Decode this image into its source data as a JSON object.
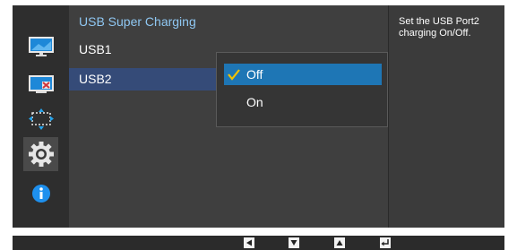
{
  "menu": {
    "title": "USB Super Charging",
    "items": [
      {
        "label": "USB1"
      },
      {
        "label": "USB2"
      }
    ]
  },
  "submenu": {
    "options": [
      {
        "label": "Off",
        "checked": true
      },
      {
        "label": "On",
        "checked": false
      }
    ]
  },
  "help": {
    "text": "Set the USB Port2 charging On/Off."
  },
  "sidebar": {
    "icons": [
      "picture-icon",
      "color-icon",
      "size-position-icon",
      "settings-gear-icon",
      "information-icon"
    ],
    "active": "settings-gear-icon"
  },
  "bottom_bar": {
    "buttons": [
      "left-arrow-icon",
      "down-arrow-icon",
      "up-arrow-icon",
      "enter-icon"
    ]
  },
  "colors": {
    "osd_bg": "#3b3b3b",
    "title_color": "#8fc7f2",
    "selected_row": "#354b78",
    "selected_option": "#1e76b5",
    "check_color": "#f2c200"
  }
}
